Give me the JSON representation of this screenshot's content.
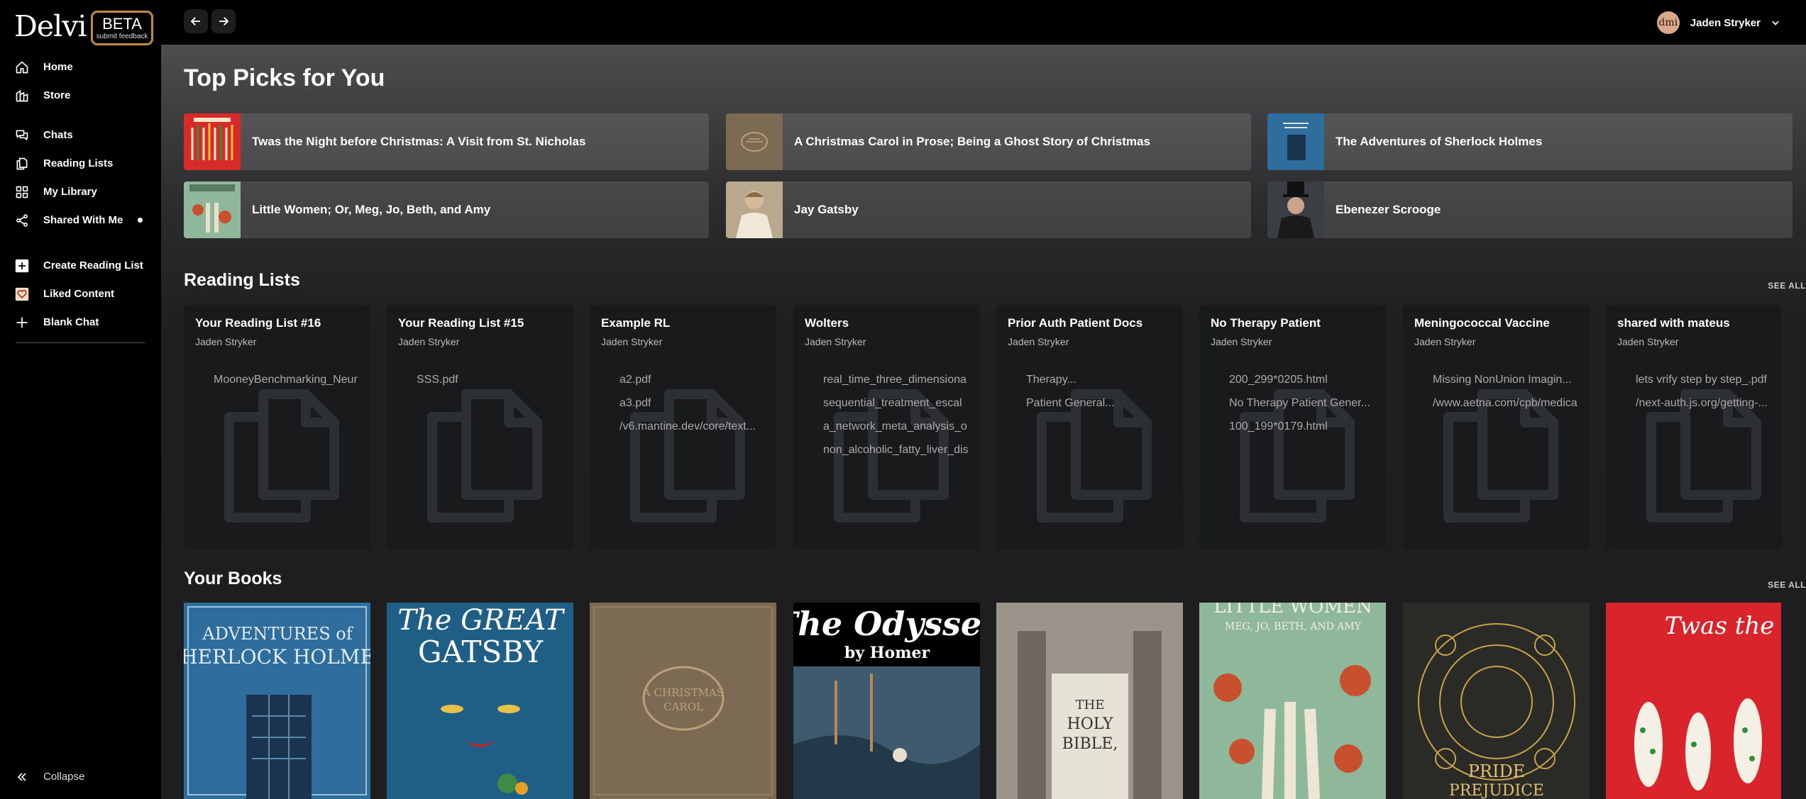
{
  "brand": {
    "logo": "Delvi",
    "beta": "BETA",
    "feedback": "submit feedback"
  },
  "sidebar": {
    "items": [
      {
        "label": "Home",
        "icon": "home-icon"
      },
      {
        "label": "Store",
        "icon": "store-icon"
      },
      {
        "label": "Chats",
        "icon": "chat-icon"
      },
      {
        "label": "Reading Lists",
        "icon": "reading-lists-icon"
      },
      {
        "label": "My Library",
        "icon": "library-grid-icon"
      },
      {
        "label": "Shared With Me",
        "icon": "share-icon"
      },
      {
        "label": "Create Reading List",
        "icon": "plus-square-icon"
      },
      {
        "label": "Liked Content",
        "icon": "heart-icon"
      },
      {
        "label": "Blank Chat",
        "icon": "plus-icon"
      }
    ],
    "collapse": "Collapse"
  },
  "header": {
    "user_name": "Jaden Stryker",
    "avatar_initials": "dmi"
  },
  "top_picks": {
    "title": "Top Picks for You",
    "items": [
      "Twas the Night before Christmas: A Visit from St. Nicholas",
      "A Christmas Carol in Prose; Being a Ghost Story of Christmas",
      "The Adventures of Sherlock Holmes",
      "Little Women; Or, Meg, Jo, Beth, and Amy",
      "Jay Gatsby",
      "Ebenezer Scrooge"
    ]
  },
  "reading_lists": {
    "title": "Reading Lists",
    "see_all": "SEE ALL",
    "cards": [
      {
        "title": "Your Reading List #16",
        "author": "Jaden Stryker",
        "items": [
          "MooneyBenchmarking_Neur"
        ]
      },
      {
        "title": "Your Reading List #15",
        "author": "Jaden Stryker",
        "items": [
          "SSS.pdf"
        ]
      },
      {
        "title": "Example RL",
        "author": "Jaden Stryker",
        "items": [
          "a2.pdf",
          "a3.pdf",
          "/v6.mantine.dev/core/text..."
        ]
      },
      {
        "title": "Wolters",
        "author": "Jaden Stryker",
        "items": [
          "real_time_three_dimensiona",
          "sequential_treatment_escal",
          "a_network_meta_analysis_o",
          "non_alcoholic_fatty_liver_dis"
        ]
      },
      {
        "title": "Prior Auth Patient Docs",
        "author": "Jaden Stryker",
        "items": [
          "Therapy...",
          "Patient General..."
        ]
      },
      {
        "title": "No Therapy Patient",
        "author": "Jaden Stryker",
        "items": [
          "200_299*0205.html",
          "No Therapy Patient Gener...",
          "100_199*0179.html"
        ]
      },
      {
        "title": "Meningococcal Vaccine",
        "author": "Jaden Stryker",
        "items": [
          "Missing NonUnion Imagin...",
          "/www.aetna.com/cpb/medica"
        ]
      },
      {
        "title": "shared with mateus",
        "author": "Jaden Stryker",
        "items": [
          "lets vrify step by step_.pdf",
          "/next-auth.js.org/getting-..."
        ]
      }
    ]
  },
  "books": {
    "title": "Your Books",
    "see_all": "SEE ALL",
    "covers": [
      {
        "title": "THE ADVENTURES OF SHERLOCK HOLMES",
        "color": "#2f6d9c"
      },
      {
        "title": "The GREAT GATSBY",
        "color": "#1f5f86"
      },
      {
        "title": "A CHRISTMAS CAROL",
        "color": "#7d6a52"
      },
      {
        "title": "The Odyssey",
        "subtitle": "by Homer",
        "color": "#000000"
      },
      {
        "title": "THE HOLY BIBLE",
        "color": "#9a948a"
      },
      {
        "title": "LITTLE WOMEN",
        "subtitle": "MEG, JO, BETH, AND AMY",
        "color": "#8fb79a"
      },
      {
        "title": "PRIDE AND PREJUDICE",
        "color": "#2a2a26"
      },
      {
        "title": "Twas the",
        "color": "#d8242a"
      }
    ]
  }
}
